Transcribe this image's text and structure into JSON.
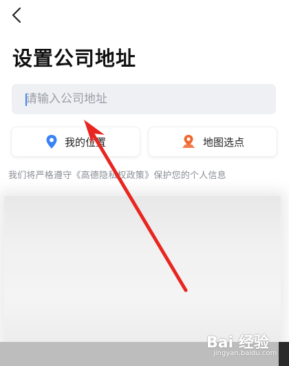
{
  "header": {
    "back_icon": "chevron-left-icon",
    "title": "设置公司地址"
  },
  "search": {
    "placeholder": "请输入公司地址",
    "value": ""
  },
  "actions": {
    "my_location": {
      "label": "我的位置",
      "icon": "location-pin-icon",
      "icon_color": "#3b82f6"
    },
    "map_pick": {
      "label": "地图选点",
      "icon": "map-pin-icon",
      "icon_color": "#f0662e"
    }
  },
  "privacy_text": "我们将严格遵守《高德隐私权政策》保护您的个人信息",
  "watermark": {
    "logo": "Bai 经验",
    "sub": "jingyan.baidu.com"
  },
  "annotation": {
    "arrow_color": "#e8261f"
  }
}
